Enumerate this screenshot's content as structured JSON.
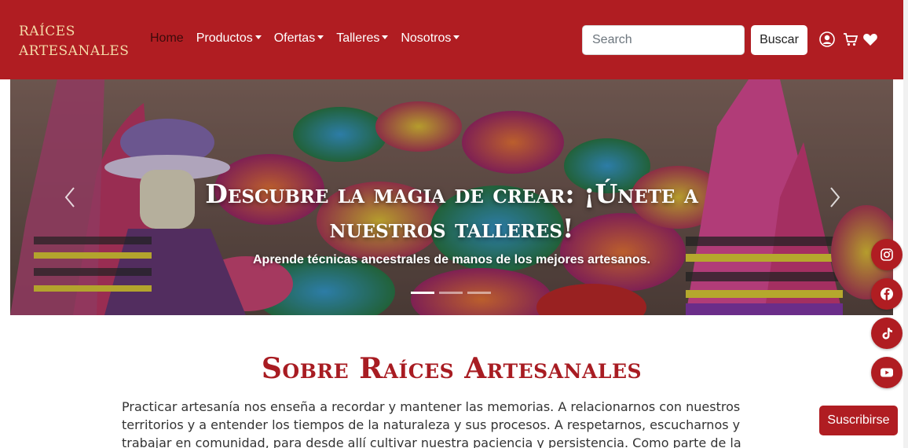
{
  "navbar": {
    "brand_line1": "RAÍCES",
    "brand_line2": "ARTESANALES",
    "links": [
      {
        "label": "Home",
        "dropdown": false
      },
      {
        "label": "Productos",
        "dropdown": true
      },
      {
        "label": "Ofertas",
        "dropdown": true
      },
      {
        "label": "Talleres",
        "dropdown": true
      },
      {
        "label": "Nosotros",
        "dropdown": true
      }
    ],
    "search": {
      "placeholder": "Search",
      "button_label": "Buscar"
    },
    "icons": [
      "user-icon",
      "cart-icon",
      "heart-icon"
    ]
  },
  "hero": {
    "title": "Descubre la magia de crear: ¡Únete a nuestros talleres!",
    "subtitle": "Aprende técnicas ancestrales de manos de los mejores artesanos.",
    "slide_count": 3,
    "active_slide": 0
  },
  "about": {
    "title": "Sobre Raíces Artesanales",
    "text": "Practicar artesanía nos enseña a recordar y mantener las memorias. A relacionarnos con nuestros territorios y a entender los tiempos de la naturaleza y sus procesos. A respetarnos, escucharnos y trabajar en comunidad, para desde allí cultivar nuestra paciencia y persistencia. Como parte de la programación del área de Cultura de"
  },
  "social": [
    "instagram-icon",
    "facebook-icon",
    "tiktok-icon",
    "youtube-icon"
  ],
  "subscribe_label": "Suscribirse",
  "colors": {
    "brand_red": "#b01d22",
    "brand_gold": "#f4dba8"
  }
}
